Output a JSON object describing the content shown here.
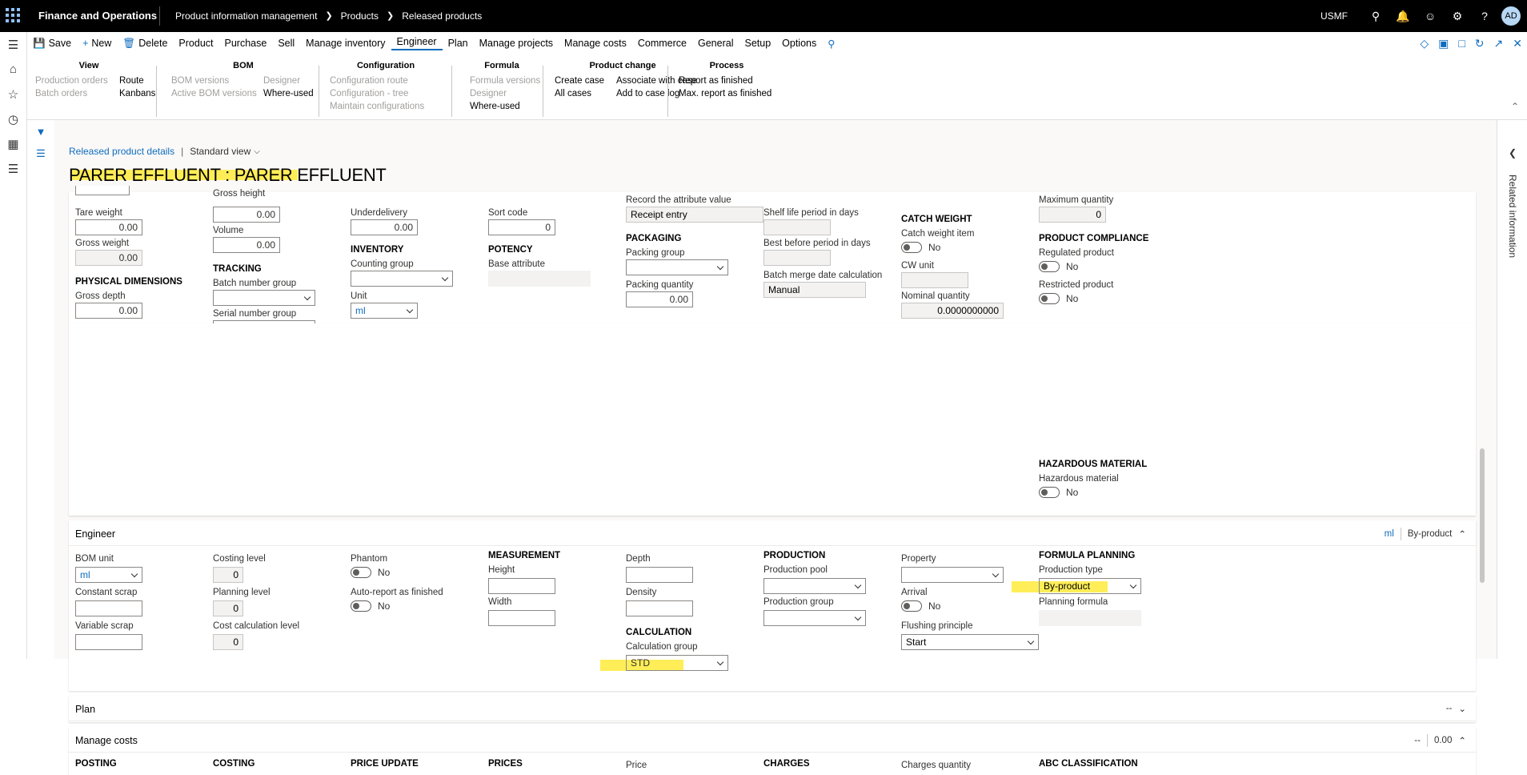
{
  "topbar": {
    "app_name": "Finance and Operations",
    "breadcrumb": [
      "Product information management",
      "Products",
      "Released products"
    ],
    "company": "USMF",
    "avatar": "AD"
  },
  "actionbar": {
    "items": [
      "Save",
      "New",
      "Delete",
      "Product",
      "Purchase",
      "Sell",
      "Manage inventory",
      "Engineer",
      "Plan",
      "Manage projects",
      "Manage costs",
      "Commerce",
      "General",
      "Setup",
      "Options"
    ],
    "selected": "Engineer"
  },
  "ribbon": {
    "view": {
      "title": "View",
      "items": [
        "Production orders",
        "Batch orders",
        "Route",
        "Kanbans"
      ]
    },
    "bom": {
      "title": "BOM",
      "items": [
        "BOM versions",
        "Active BOM versions",
        "Designer",
        "Where-used"
      ]
    },
    "configuration": {
      "title": "Configuration",
      "items": [
        "Configuration route",
        "Configuration - tree",
        "Maintain configurations"
      ]
    },
    "formula": {
      "title": "Formula",
      "items": [
        "Formula versions",
        "Designer",
        "Where-used"
      ]
    },
    "product_change": {
      "title": "Product change",
      "items": [
        "Create case",
        "All cases",
        "Associate with case",
        "Add to case log"
      ]
    },
    "process": {
      "title": "Process",
      "items": [
        "Report as finished",
        "Max. report as finished"
      ]
    }
  },
  "page": {
    "breadcrumb_link": "Released product details",
    "view_name": "Standard view",
    "title": "PARER EFFLUENT : PARER EFFLUENT",
    "related_info": "Related information"
  },
  "upper": {
    "tare_weight_label": "Tare weight",
    "tare_weight": "0.00",
    "gross_weight_label": "Gross weight",
    "gross_weight": "0.00",
    "phys_dim": "PHYSICAL DIMENSIONS",
    "gross_depth_label": "Gross depth",
    "gross_depth": "0.00",
    "gross_height_label": "Gross height",
    "gross_height": "0.00",
    "volume_label": "Volume",
    "volume": "0.00",
    "tracking": "TRACKING",
    "batch_group_label": "Batch number group",
    "serial_group_label": "Serial number group",
    "underdelivery_label": "Underdelivery",
    "underdelivery": "0.00",
    "inventory": "INVENTORY",
    "counting_group_label": "Counting group",
    "unit_label": "Unit",
    "unit": "ml",
    "sort_code_label": "Sort code",
    "sort_code": "0",
    "potency": "POTENCY",
    "base_attr_label": "Base attribute",
    "record_attr_label": "Record the attribute value",
    "record_attr": "Receipt entry",
    "packaging": "PACKAGING",
    "packing_group_label": "Packing group",
    "packing_qty_label": "Packing quantity",
    "packing_qty": "0.00",
    "shelf_life_label": "Shelf life period in days",
    "best_before_label": "Best before period in days",
    "batch_merge_label": "Batch merge date calculation",
    "batch_merge": "Manual",
    "catch_weight": "CATCH WEIGHT",
    "catch_item_label": "Catch weight item",
    "catch_item": "No",
    "cw_unit_label": "CW unit",
    "nominal_qty_label": "Nominal quantity",
    "nominal_qty": "0.0000000000",
    "max_qty_label": "Maximum quantity",
    "max_qty": "0",
    "compliance": "PRODUCT COMPLIANCE",
    "regulated_label": "Regulated product",
    "regulated": "No",
    "restricted_label": "Restricted product",
    "restricted": "No",
    "hazmat": "HAZARDOUS MATERIAL",
    "hazmat_label": "Hazardous material",
    "hazmat_val": "No"
  },
  "engineer": {
    "title": "Engineer",
    "summary_unit": "ml",
    "summary_type": "By-product",
    "bom_unit_label": "BOM unit",
    "bom_unit": "ml",
    "constant_scrap_label": "Constant scrap",
    "variable_scrap_label": "Variable scrap",
    "costing_level_label": "Costing level",
    "costing_level": "0",
    "planning_level_label": "Planning level",
    "planning_level": "0",
    "cost_calc_level_label": "Cost calculation level",
    "cost_calc_level": "0",
    "phantom_label": "Phantom",
    "phantom": "No",
    "auto_report_label": "Auto-report as finished",
    "auto_report": "No",
    "measurement": "MEASUREMENT",
    "height_label": "Height",
    "width_label": "Width",
    "depth_label": "Depth",
    "density_label": "Density",
    "calculation": "CALCULATION",
    "calc_group_label": "Calculation group",
    "calc_group": "STD",
    "production": "PRODUCTION",
    "prod_pool_label": "Production pool",
    "prod_group_label": "Production group",
    "property_label": "Property",
    "arrival_label": "Arrival",
    "arrival": "No",
    "flushing_label": "Flushing principle",
    "flushing": "Start",
    "formula_planning": "FORMULA PLANNING",
    "prod_type_label": "Production type",
    "prod_type": "By-product",
    "planning_formula_label": "Planning formula"
  },
  "plan": {
    "title": "Plan",
    "summary": "--"
  },
  "manage_costs": {
    "title": "Manage costs",
    "summary1": "--",
    "summary2": "0.00",
    "sections": [
      "POSTING",
      "COSTING",
      "PRICE UPDATE",
      "PRICES",
      "Price",
      "CHARGES",
      "Charges quantity",
      "ABC CLASSIFICATION"
    ]
  }
}
